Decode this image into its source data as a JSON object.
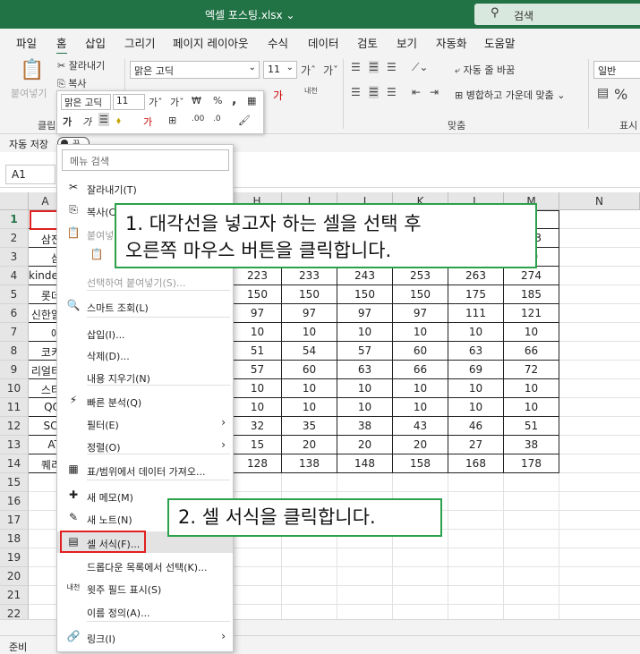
{
  "titlebar": {
    "document": "엑셀 포스팅.xlsx ⌄",
    "search_placeholder": "검색"
  },
  "tabs": [
    "파일",
    "홈",
    "삽입",
    "그리기",
    "페이지 레이아웃",
    "수식",
    "데이터",
    "검토",
    "보기",
    "자동화",
    "도움말"
  ],
  "ribbon": {
    "paste": "붙여넣기",
    "cut": "잘라내기",
    "copy": "복사",
    "clipboard_group": "클립",
    "font_name": "맑은 고딕",
    "font_size": "11",
    "wrap_text": "자동 줄 바꿈",
    "merge_center": "병합하고 가운데 맞춤",
    "align_group": "맞춤",
    "number_format": "일반",
    "percent": "%",
    "display_group": "표시"
  },
  "qat": {
    "autosave": "자동 저장",
    "autosave_state": "끔"
  },
  "namebox": "A1",
  "columns": [
    "A",
    "H",
    "I",
    "J",
    "K",
    "L",
    "M",
    "N"
  ],
  "rows": [
    "1",
    "2",
    "3",
    "4",
    "5",
    "6",
    "7",
    "8",
    "9",
    "10",
    "11",
    "12",
    "13",
    "14",
    "15",
    "16",
    "17",
    "18",
    "19",
    "20",
    "21",
    "22"
  ],
  "col_a_values": [
    "",
    "삼전",
    "삼",
    "kindex",
    "롯데",
    "신한알",
    "애",
    "코카",
    "리얼티",
    "스타",
    "QQ",
    "SCI",
    "AT",
    "퀘리"
  ],
  "table": [
    [
      "",
      "",
      "",
      "",
      "",
      "12"
    ],
    [
      "",
      "",
      "",
      "",
      "",
      "183"
    ],
    [
      "",
      "",
      "",
      "",
      "",
      "20"
    ],
    [
      "223",
      "233",
      "243",
      "253",
      "263",
      "274"
    ],
    [
      "150",
      "150",
      "150",
      "150",
      "175",
      "185"
    ],
    [
      "97",
      "97",
      "97",
      "97",
      "111",
      "121"
    ],
    [
      "10",
      "10",
      "10",
      "10",
      "10",
      "10"
    ],
    [
      "51",
      "54",
      "57",
      "60",
      "63",
      "66"
    ],
    [
      "57",
      "60",
      "63",
      "66",
      "69",
      "72"
    ],
    [
      "10",
      "10",
      "10",
      "10",
      "10",
      "10"
    ],
    [
      "10",
      "10",
      "10",
      "10",
      "10",
      "10"
    ],
    [
      "32",
      "35",
      "38",
      "43",
      "46",
      "51"
    ],
    [
      "15",
      "20",
      "20",
      "20",
      "27",
      "38"
    ],
    [
      "128",
      "138",
      "148",
      "158",
      "168",
      "178"
    ]
  ],
  "mini_toolbar": {
    "font": "맑은 고딕",
    "size": "11"
  },
  "context_menu": {
    "search": "메뉴 검색",
    "items": [
      {
        "label": "잘라내기(T)",
        "icon": "scissors-icon",
        "glyph": "✂"
      },
      {
        "label": "복사(C)",
        "icon": "copy-icon",
        "glyph": "⎘"
      },
      {
        "label": "붙여넣기 옵션:",
        "icon": "paste-icon",
        "glyph": "📋"
      },
      {
        "label": "",
        "icon": "paste-option-icon",
        "glyph": "📋"
      },
      {
        "label": "선택하여 붙여넣기(S)...",
        "icon": "",
        "glyph": ""
      },
      {
        "label": "스마트 조회(L)",
        "icon": "smart-lookup-icon",
        "glyph": "🔍"
      },
      {
        "label": "삽입(I)...",
        "icon": "",
        "glyph": ""
      },
      {
        "label": "삭제(D)...",
        "icon": "",
        "glyph": ""
      },
      {
        "label": "내용 지우기(N)",
        "icon": "",
        "glyph": ""
      },
      {
        "label": "빠른 분석(Q)",
        "icon": "quick-analysis-icon",
        "glyph": "⚡"
      },
      {
        "label": "필터(E)",
        "icon": "",
        "glyph": ""
      },
      {
        "label": "정렬(O)",
        "icon": "",
        "glyph": ""
      },
      {
        "label": "표/범위에서 데이터 가져오...",
        "icon": "table-icon",
        "glyph": "▦"
      },
      {
        "label": "새 메모(M)",
        "icon": "new-comment-icon",
        "glyph": "✚"
      },
      {
        "label": "새 노트(N)",
        "icon": "new-note-icon",
        "glyph": "✎"
      },
      {
        "label": "셀 서식(F)...",
        "icon": "format-cells-icon",
        "glyph": "▤"
      },
      {
        "label": "드롭다운 목록에서 선택(K)...",
        "icon": "",
        "glyph": ""
      },
      {
        "label": "윗주 필드 표시(S)",
        "icon": "phonetic-icon",
        "glyph": "내천"
      },
      {
        "label": "이름 정의(A)...",
        "icon": "",
        "glyph": ""
      },
      {
        "label": "링크(I)",
        "icon": "link-icon",
        "glyph": "🔗"
      }
    ]
  },
  "callouts": {
    "step1_line1": "1. 대각선을 넣고자 하는 셀을 선택 후",
    "step1_line2": "오른쪽 마우스 버튼을 클릭합니다.",
    "step2": "2. 셀 서식을 클릭합니다."
  },
  "status": {
    "ready": "준비"
  },
  "colors": {
    "brand": "#217346",
    "callout_border": "#2aa14a",
    "highlight_box": "#e02020"
  }
}
